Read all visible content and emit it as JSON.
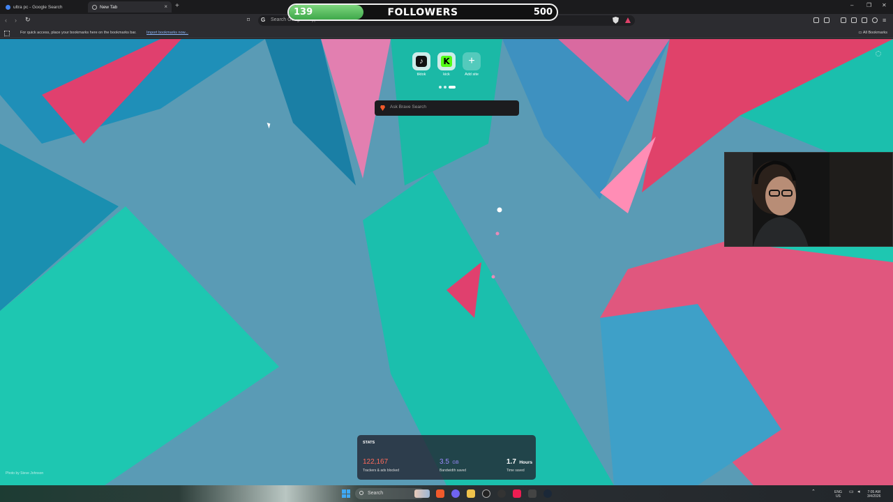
{
  "browser": {
    "tabs": [
      {
        "title": "ultra pc - Google Search",
        "active": false
      },
      {
        "title": "New Tab",
        "active": true
      }
    ],
    "address_placeholder": "Search Google or type a URL",
    "bookmarks_bar_text": "For quick access, place your bookmarks here on the bookmarks bar.",
    "import_bookmarks_link": "Import bookmarks now...",
    "all_bookmarks_label": "All Bookmarks"
  },
  "followers_goal": {
    "current": "139",
    "label": "FOLLOWERS",
    "goal": "500",
    "progress_fraction": 0.278
  },
  "new_tab": {
    "top_sites": [
      {
        "label": "tiktok",
        "icon": "tiktok-icon"
      },
      {
        "label": "kick",
        "icon": "kick-icon"
      },
      {
        "label": "Add site",
        "icon": "plus-icon"
      }
    ],
    "search_placeholder": "Ask Brave Search",
    "photo_credit": "Photo by Steve Johnson",
    "stats": {
      "title": "STATS",
      "trackers": {
        "value": "122,167",
        "caption": "Trackers & ads blocked",
        "color": "#ff6b5b"
      },
      "bandwidth": {
        "value": "3.5",
        "unit": "GB",
        "caption": "Bandwidth saved",
        "color": "#9b8cff"
      },
      "time": {
        "value": "1.7",
        "unit": "Hours",
        "caption": "Time saved",
        "color": "#ffffff"
      }
    }
  },
  "taskbar": {
    "search_label": "Search",
    "lang": "ENG",
    "region": "US",
    "time": "7:05 AM",
    "date": "3/4/2026"
  },
  "colors": {
    "accent_green": "#53fc18",
    "brave_orange": "#f15a2b"
  }
}
